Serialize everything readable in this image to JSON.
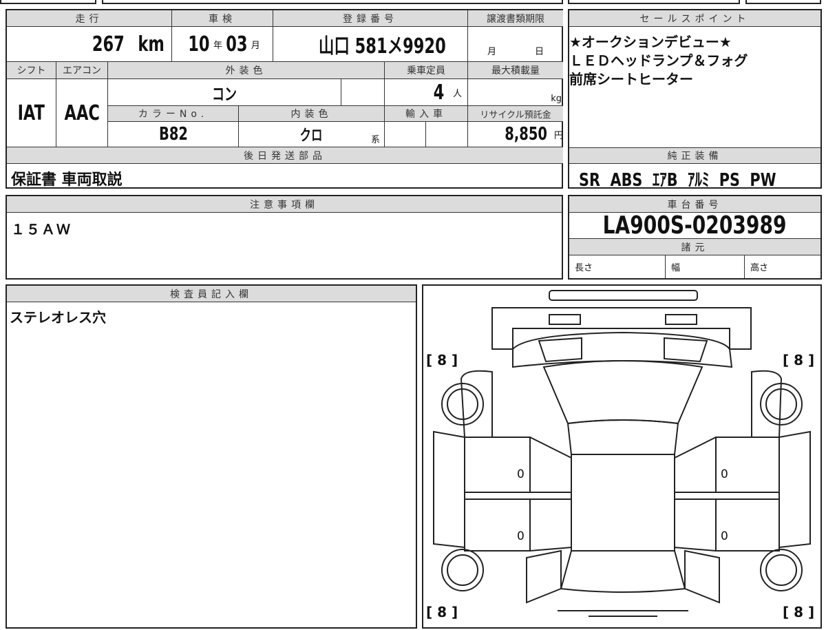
{
  "table": {
    "mileage_label": "走行",
    "mileage_value": "267",
    "mileage_unit": "km",
    "inspection_label": "車検",
    "inspection_year": "10",
    "year_unit": "年",
    "inspection_month": "03",
    "month_unit": "月",
    "plate_label": "登録番号",
    "plate_value": "山口 581メ9920",
    "transfer_label": "譲渡書類期限",
    "transfer_month": "月",
    "transfer_day": "日",
    "shift_label": "シフト",
    "shift_value": "IAT",
    "ac_label": "エアコン",
    "ac_value": "AAC",
    "exterior_label": "外装色",
    "exterior_value": "コン",
    "capacity_label": "乗車定員",
    "capacity_value": "4",
    "capacity_unit": "人",
    "load_label": "最大積載量",
    "load_unit": "kg",
    "color_no_label": "カラーNo.",
    "color_no_value": "B82",
    "interior_label": "内装色",
    "interior_value": "クロ",
    "interior_unit": "系",
    "import_label": "輸入車",
    "recycle_label": "リサイクル預託金",
    "recycle_value": "8,850",
    "recycle_unit": "円",
    "later_parts_label": "後日発送部品",
    "later_parts_value": "保証書 車両取説"
  },
  "sales": {
    "label": "セールスポイント",
    "lines": [
      "★オークションデビュー★",
      "ＬＥＤヘッドランプ＆フォグ",
      "前席シートヒーター"
    ]
  },
  "equipment": {
    "label": "純正装備",
    "value": "SR  ABS  ｴｱB  ｱﾙﾐ  PS  PW"
  },
  "notes": {
    "label": "注意事項欄",
    "value": "１５ＡＷ"
  },
  "chassis": {
    "label": "車台番号",
    "value": "LA900S-0203989"
  },
  "specs": {
    "label": "諸元",
    "length": "長さ",
    "width": "幅",
    "height": "高さ"
  },
  "inspector": {
    "label": "検査員記入欄",
    "value": "ステレオレス穴"
  },
  "diagram": {
    "tire_fl": "[ 8 ]",
    "tire_fr": "[ 8 ]",
    "tire_rl": "[ 8 ]",
    "tire_rr": "[ 8 ]",
    "mark1": "0",
    "mark2": "0",
    "mark3": "0",
    "mark4": "0"
  }
}
